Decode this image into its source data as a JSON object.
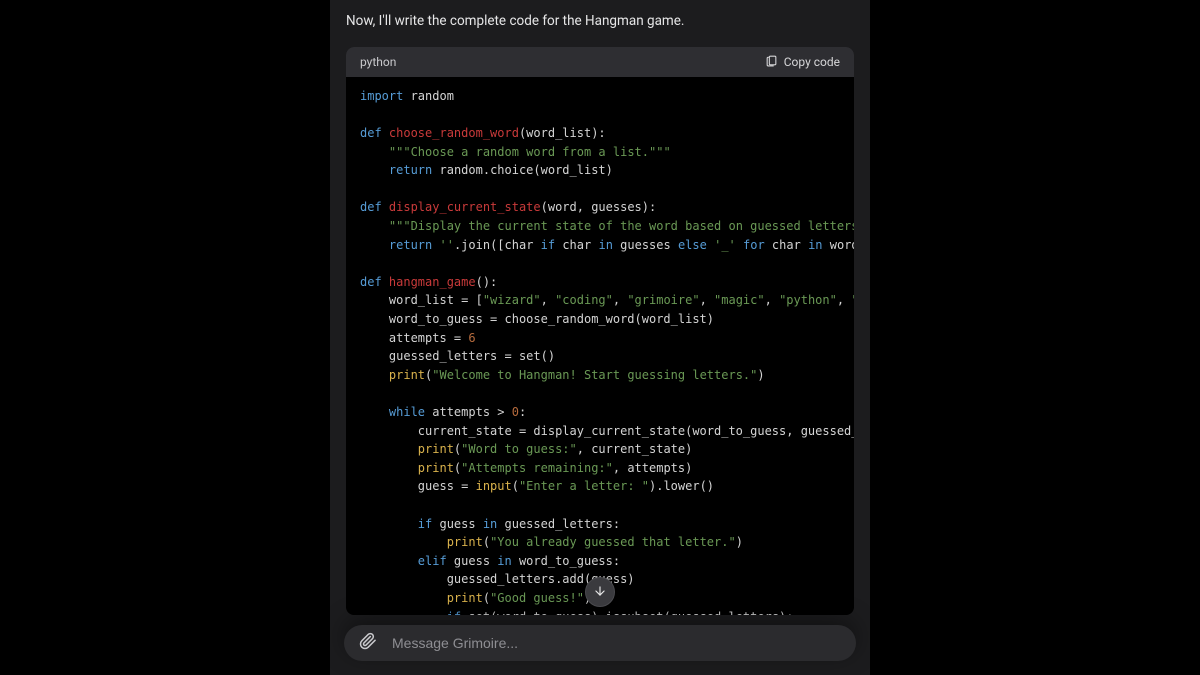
{
  "intro_text": "Now, I'll write the complete code for the Hangman game.",
  "code": {
    "language": "python",
    "copy_label": "Copy code",
    "tokens": [
      [
        [
          "kw",
          "import"
        ],
        [
          "id",
          " random"
        ]
      ],
      [],
      [
        [
          "kw",
          "def "
        ],
        [
          "fn",
          "choose_random_word"
        ],
        [
          "id",
          "(word_list):"
        ]
      ],
      [
        [
          "id",
          "    "
        ],
        [
          "str",
          "\"\"\"Choose a random word from a list.\"\"\""
        ]
      ],
      [
        [
          "id",
          "    "
        ],
        [
          "kw",
          "return"
        ],
        [
          "id",
          " random.choice(word_list)"
        ]
      ],
      [],
      [
        [
          "kw",
          "def "
        ],
        [
          "fn",
          "display_current_state"
        ],
        [
          "id",
          "(word, guesses):"
        ]
      ],
      [
        [
          "id",
          "    "
        ],
        [
          "str",
          "\"\"\"Display the current state of the word based on guessed letters.\""
        ]
      ],
      [
        [
          "id",
          "    "
        ],
        [
          "kw",
          "return"
        ],
        [
          "id",
          " "
        ],
        [
          "str",
          "''"
        ],
        [
          "id",
          ".join([char "
        ],
        [
          "kw",
          "if"
        ],
        [
          "id",
          " char "
        ],
        [
          "kw",
          "in"
        ],
        [
          "id",
          " guesses "
        ],
        [
          "kw",
          "else"
        ],
        [
          "id",
          " "
        ],
        [
          "str",
          "'_'"
        ],
        [
          "id",
          " "
        ],
        [
          "kw",
          "for"
        ],
        [
          "id",
          " char "
        ],
        [
          "kw",
          "in"
        ],
        [
          "id",
          " word])"
        ]
      ],
      [],
      [
        [
          "kw",
          "def "
        ],
        [
          "fn",
          "hangman_game"
        ],
        [
          "id",
          "():"
        ]
      ],
      [
        [
          "id",
          "    word_list = ["
        ],
        [
          "str",
          "\"wizard\""
        ],
        [
          "id",
          ", "
        ],
        [
          "str",
          "\"coding\""
        ],
        [
          "id",
          ", "
        ],
        [
          "str",
          "\"grimoire\""
        ],
        [
          "id",
          ", "
        ],
        [
          "str",
          "\"magic\""
        ],
        [
          "id",
          ", "
        ],
        [
          "str",
          "\"python\""
        ],
        [
          "id",
          ", "
        ],
        [
          "str",
          "\"ha"
        ]
      ],
      [
        [
          "id",
          "    word_to_guess = choose_random_word(word_list)"
        ]
      ],
      [
        [
          "id",
          "    attempts = "
        ],
        [
          "num",
          "6"
        ]
      ],
      [
        [
          "id",
          "    guessed_letters = set()"
        ]
      ],
      [
        [
          "id",
          "    "
        ],
        [
          "bi",
          "print"
        ],
        [
          "id",
          "("
        ],
        [
          "str",
          "\"Welcome to Hangman! Start guessing letters.\""
        ],
        [
          "id",
          ")"
        ]
      ],
      [],
      [
        [
          "id",
          "    "
        ],
        [
          "kw",
          "while"
        ],
        [
          "id",
          " attempts > "
        ],
        [
          "num",
          "0"
        ],
        [
          "id",
          ":"
        ]
      ],
      [
        [
          "id",
          "        current_state = display_current_state(word_to_guess, guessed_le"
        ]
      ],
      [
        [
          "id",
          "        "
        ],
        [
          "bi",
          "print"
        ],
        [
          "id",
          "("
        ],
        [
          "str",
          "\"Word to guess:\""
        ],
        [
          "id",
          ", current_state)"
        ]
      ],
      [
        [
          "id",
          "        "
        ],
        [
          "bi",
          "print"
        ],
        [
          "id",
          "("
        ],
        [
          "str",
          "\"Attempts remaining:\""
        ],
        [
          "id",
          ", attempts)"
        ]
      ],
      [
        [
          "id",
          "        guess = "
        ],
        [
          "bi",
          "input"
        ],
        [
          "id",
          "("
        ],
        [
          "str",
          "\"Enter a letter: \""
        ],
        [
          "id",
          ").lower()"
        ]
      ],
      [],
      [
        [
          "id",
          "        "
        ],
        [
          "kw",
          "if"
        ],
        [
          "id",
          " guess "
        ],
        [
          "kw",
          "in"
        ],
        [
          "id",
          " guessed_letters:"
        ]
      ],
      [
        [
          "id",
          "            "
        ],
        [
          "bi",
          "print"
        ],
        [
          "id",
          "("
        ],
        [
          "str",
          "\"You already guessed that letter.\""
        ],
        [
          "id",
          ")"
        ]
      ],
      [
        [
          "id",
          "        "
        ],
        [
          "kw",
          "elif"
        ],
        [
          "id",
          " guess "
        ],
        [
          "kw",
          "in"
        ],
        [
          "id",
          " word_to_guess:"
        ]
      ],
      [
        [
          "id",
          "            guessed_letters.add(guess)"
        ]
      ],
      [
        [
          "id",
          "            "
        ],
        [
          "bi",
          "print"
        ],
        [
          "id",
          "("
        ],
        [
          "str",
          "\"Good guess!\""
        ],
        [
          "id",
          ")"
        ]
      ],
      [
        [
          "id",
          "            "
        ],
        [
          "kw",
          "if"
        ],
        [
          "id",
          " set(word_to_guess).issubset(guessed_letters):"
        ]
      ]
    ]
  },
  "composer": {
    "placeholder": "Message Grimoire..."
  },
  "icons": {
    "clipboard": "clipboard-icon",
    "attach": "paperclip-icon",
    "scroll_down": "arrow-down-icon"
  }
}
